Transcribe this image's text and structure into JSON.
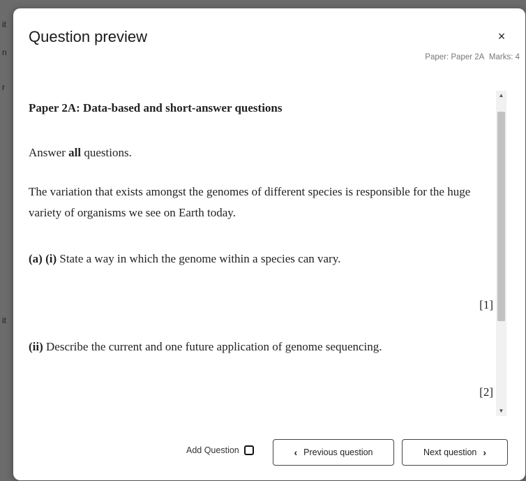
{
  "background": {
    "edge_fragments": [
      "it",
      "n",
      "r",
      "it"
    ]
  },
  "modal": {
    "title": "Question preview",
    "close_icon": "×",
    "paper_label": "Paper: Paper 2A",
    "marks_label": "Marks: 4"
  },
  "question": {
    "heading": "Paper 2A: Data-based and short-answer questions",
    "instruction_prefix": "Answer ",
    "instruction_bold": "all",
    "instruction_suffix": " questions.",
    "intro": "The variation that exists amongst the genomes of different species is responsible for the huge variety of organisms we see on Earth today.",
    "part_a_label": "(a) (i)",
    "part_a_text": " State a way in which the genome within a species can vary.",
    "part_a_marks": "[1]",
    "part_b_label": "(ii)",
    "part_b_text": " Describe the current and one future application of genome sequencing.",
    "part_b_marks": "[2]"
  },
  "scrollbar": {
    "up_icon": "▲",
    "down_icon": "▼"
  },
  "footer": {
    "add_question_label": "Add Question",
    "add_question_checked": false,
    "prev_icon": "‹",
    "prev_label": "Previous question",
    "next_label": "Next question",
    "next_icon": "›"
  }
}
